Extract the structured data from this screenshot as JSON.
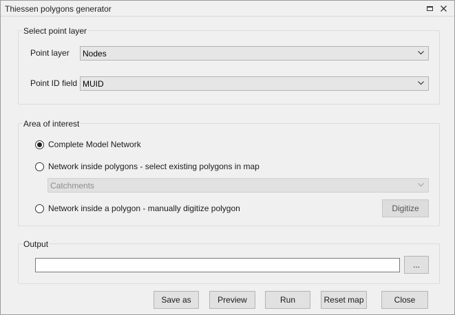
{
  "window": {
    "title": "Thiessen polygons generator"
  },
  "icons": {
    "maximize": "maximize-icon",
    "close": "close-x-icon",
    "dropdown": "chevron-down-icon"
  },
  "point_layer_group": {
    "legend": "Select point layer",
    "point_layer": {
      "label": "Point layer",
      "value": "Nodes"
    },
    "point_id_field": {
      "label": "Point ID field",
      "value": "MUID"
    }
  },
  "area_group": {
    "legend": "Area of interest",
    "options": [
      {
        "label": "Complete Model Network",
        "checked": true
      },
      {
        "label": "Network inside polygons - select existing polygons in map",
        "checked": false
      },
      {
        "label": "Network inside a polygon - manually digitize polygon",
        "checked": false
      }
    ],
    "polygon_layer": {
      "value": "Catchments",
      "enabled": false
    },
    "digitize_label": "Digitize"
  },
  "output_group": {
    "legend": "Output",
    "path_value": "",
    "browse_label": "..."
  },
  "buttons": {
    "save_as": "Save as",
    "preview": "Preview",
    "run": "Run",
    "reset_map": "Reset map",
    "close": "Close"
  }
}
